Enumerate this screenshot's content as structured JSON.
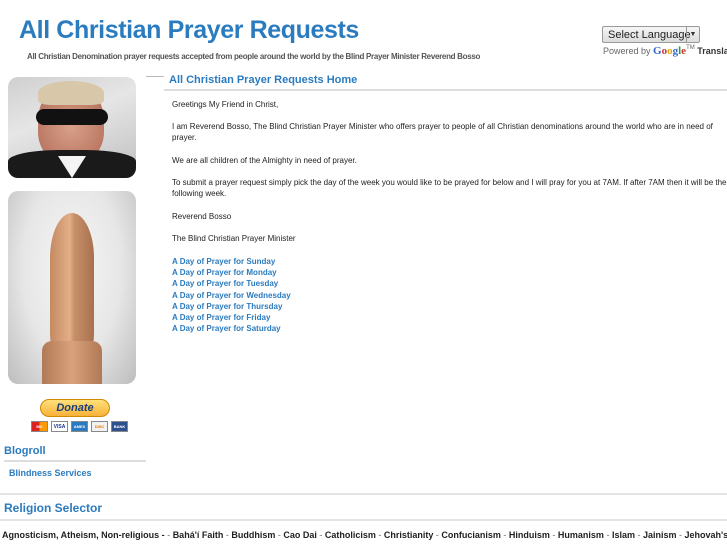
{
  "header": {
    "title": "All Christian Prayer Requests",
    "tagline": "All Christian Denomination prayer requests accepted from people around the world by the Blind Prayer Minister Reverend Bosso"
  },
  "translate": {
    "select_label": "Select Language",
    "powered_by": "Powered by",
    "google_letters": [
      "G",
      "o",
      "o",
      "g",
      "l",
      "e"
    ],
    "tm": "TM",
    "translate_label": "Translate"
  },
  "sidebar": {
    "donate_label": "Donate",
    "cards": [
      "MC",
      "VISA",
      "AMEX",
      "DISC",
      "BANK"
    ],
    "blogroll_title": "Blogroll",
    "blogroll_links": [
      "Blindness Services"
    ]
  },
  "main": {
    "title": "All Christian Prayer Requests Home",
    "paragraphs": [
      "Greetings My Friend in Christ,",
      "I am Reverend Bosso, The Blind Christian Prayer Minister who offers prayer to people of all Christian denominations around the world who are in need of prayer.",
      "We are all children of the Almighty in need of prayer.",
      "To submit a prayer request simply pick the day of the week you would like to be prayed for below and I will pray for you at 7AM. If after 7AM then it will be the following week.",
      "Reverend Bosso",
      "The Blind Christian Prayer Minister"
    ],
    "days": [
      "A Day of Prayer for Sunday",
      "A Day of Prayer for Monday",
      "A Day of Prayer for Tuesday",
      "A Day of Prayer for Wednesday",
      "A Day of Prayer for Thursday",
      "A Day of Prayer for Friday",
      "A Day of Prayer for Saturday"
    ]
  },
  "religion": {
    "title": "Religion Selector",
    "items": [
      "Agnosticism, Atheism, Non-religious -",
      "Bahá'í Faith",
      "Buddhism",
      "Cao Dai",
      "Catholicism",
      "Christianity",
      "Confucianism",
      "Hinduism",
      "Humanism",
      "Islam",
      "Jainism",
      "Jehovah's"
    ],
    "separator": " - "
  },
  "colors": {
    "accent": "#2b7bbf",
    "rule": "#dddddd",
    "text": "#222222"
  }
}
